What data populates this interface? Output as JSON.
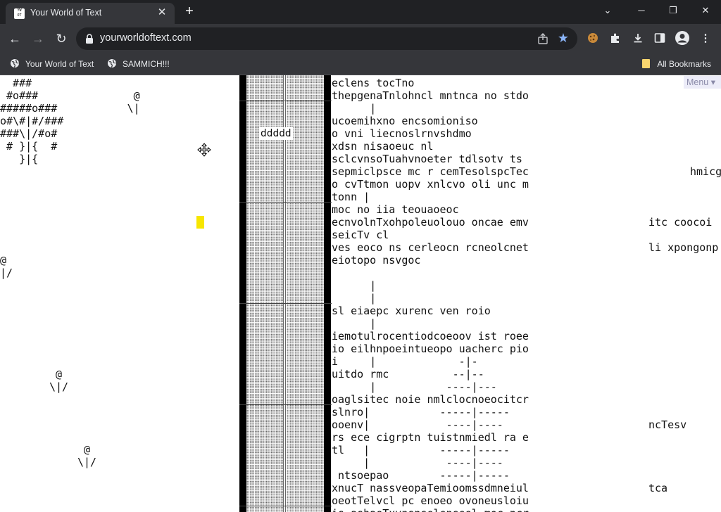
{
  "browser": {
    "tab": {
      "title": "Your World of Text",
      "favicon_text": "YW\nOT"
    },
    "window_controls": {
      "minimize": "─",
      "restore": "❐",
      "close": "✕",
      "tab_search": "⌄"
    },
    "url": "yourworldoftext.com",
    "bookmarks": [
      {
        "label": "Your World of Text",
        "icon": "globe-icon"
      },
      {
        "label": "SAMMICH!!!",
        "icon": "globe-icon"
      }
    ],
    "all_bookmarks_label": "All Bookmarks"
  },
  "canvas": {
    "menu_label": "Menu ▾",
    "box_label": "ddddd",
    "left_art": "  ###\n #o###               @\n#####o###           \\|\no#\\#|#/###\n###\\|/#o#\n # }|{  #\n   }|{",
    "far_left_art": "@\n|/",
    "fig_two": " @\n\\|/",
    "fig_three": " @\n\\|/",
    "text_block": "eclens tocTno\nthepgenaTnlohncl mntnca no stdo\n      |\nucoemihxno encsomioniso\no vni liecnoslrnvshdmo\nxdsn nisaoeuc nl\nsclcvnsoTuahvnoeter tdlsotv ts\nsepmiclpsce mc r cemTesolspcTec\no cvTtmon uopv xnlcvo oli unc m\ntonn |\nmoc no iia teouaoeoc\necnvolnTxohpoleuolouo oncae emv\nseicTv cl\nves eoco ns cerleocn rcneolcnet\neiotopo nsvgoc\n\n      |\n      |\nsl eiaepc xurenc ven roio\n      |\niemotulrocentiodcoeoov ist roee\nio eilhnpoeintueopo uacherc pio\ni     |             -|-\nuitdo rmc          --|--\n      |           ----|---\noaglsitec noie nmlclocnoeocitcr\nslnro|           -----|-----\nooenv|            ----|----\nrs ece cigrptn tuistnmiedl ra e\ntl   |           -----|-----\n     |            ----|----\n ntsoepao        -----|-----\nxnucT nassveopaTemioomssdmneiul\noeotTelvcl pc enoeo ovoneusloiu\nis ashaeTxvnspselenseel moc pcr",
    "right_col_text": "\n\n\n\n\n\n\n\n\n\n\nitc coocoi\n\nli xpongonp\n\n\n\n\n\n\n\n\n\n\n\n\n\nncTesv\n\n\n\n\ntca",
    "far_right_text": "hmicg"
  }
}
